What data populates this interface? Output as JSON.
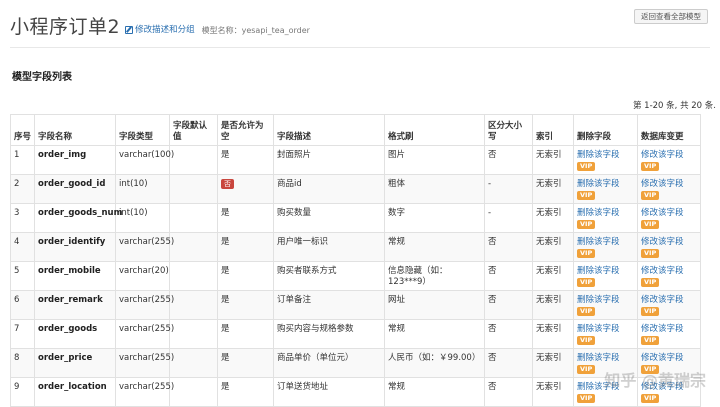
{
  "header": {
    "title": "小程序订单2",
    "edit_link": "修改描述和分组",
    "model_name": "模型名称：yesapi_tea_order",
    "back_button": "返回查看全部模型"
  },
  "section_title": "模型字段列表",
  "paging": "第 1-20 条, 共 20 条.",
  "columns": [
    "序号",
    "字段名称",
    "字段类型",
    "字段默认值",
    "是否允许为空",
    "字段描述",
    "格式刷",
    "区分大小写",
    "索引",
    "删除字段",
    "数据库变更"
  ],
  "rows": [
    {
      "no": "1",
      "name": "order_img",
      "type": "varchar(100)",
      "default": "",
      "nullable": "是",
      "desc": "封面照片",
      "format": "图片",
      "case": "否",
      "index": "无索引",
      "del": "删除该字段",
      "mod": "修改该字段",
      "vip": "VIP"
    },
    {
      "no": "2",
      "name": "order_good_id",
      "type": "int(10)",
      "default": "",
      "nullable": "否",
      "desc": "商品id",
      "format": "粗体",
      "case": "-",
      "index": "无索引",
      "del": "删除该字段",
      "mod": "修改该字段",
      "vip": "VIP"
    },
    {
      "no": "3",
      "name": "order_goods_num",
      "type": "int(10)",
      "default": "",
      "nullable": "是",
      "desc": "购买数量",
      "format": "数字",
      "case": "-",
      "index": "无索引",
      "del": "删除该字段",
      "mod": "修改该字段",
      "vip": "VIP"
    },
    {
      "no": "4",
      "name": "order_identify",
      "type": "varchar(255)",
      "default": "",
      "nullable": "是",
      "desc": "用户唯一标识",
      "format": "常规",
      "case": "否",
      "index": "无索引",
      "del": "删除该字段",
      "mod": "修改该字段",
      "vip": "VIP"
    },
    {
      "no": "5",
      "name": "order_mobile",
      "type": "varchar(20)",
      "default": "",
      "nullable": "是",
      "desc": "购买者联系方式",
      "format": "信息隐藏（如：123***9）",
      "case": "否",
      "index": "无索引",
      "del": "删除该字段",
      "mod": "修改该字段",
      "vip": "VIP"
    },
    {
      "no": "6",
      "name": "order_remark",
      "type": "varchar(255)",
      "default": "",
      "nullable": "是",
      "desc": "订单备注",
      "format": "网址",
      "case": "否",
      "index": "无索引",
      "del": "删除该字段",
      "mod": "修改该字段",
      "vip": "VIP"
    },
    {
      "no": "7",
      "name": "order_goods",
      "type": "varchar(255)",
      "default": "",
      "nullable": "是",
      "desc": "购买内容与规格参数",
      "format": "常规",
      "case": "否",
      "index": "无索引",
      "del": "删除该字段",
      "mod": "修改该字段",
      "vip": "VIP"
    },
    {
      "no": "8",
      "name": "order_price",
      "type": "varchar(255)",
      "default": "",
      "nullable": "是",
      "desc": "商品单价（单位元）",
      "format": "人民币（如：￥99.00）",
      "case": "否",
      "index": "无索引",
      "del": "删除该字段",
      "mod": "修改该字段",
      "vip": "VIP"
    },
    {
      "no": "9",
      "name": "order_location",
      "type": "varchar(255)",
      "default": "",
      "nullable": "是",
      "desc": "订单送货地址",
      "format": "常规",
      "case": "否",
      "index": "无索引",
      "del": "删除该字段",
      "mod": "修改该字段",
      "vip": "VIP"
    }
  ],
  "colors": {
    "link": "#2a6fb0",
    "vip": "#f0a13a",
    "no_badge": "#c9463d"
  }
}
